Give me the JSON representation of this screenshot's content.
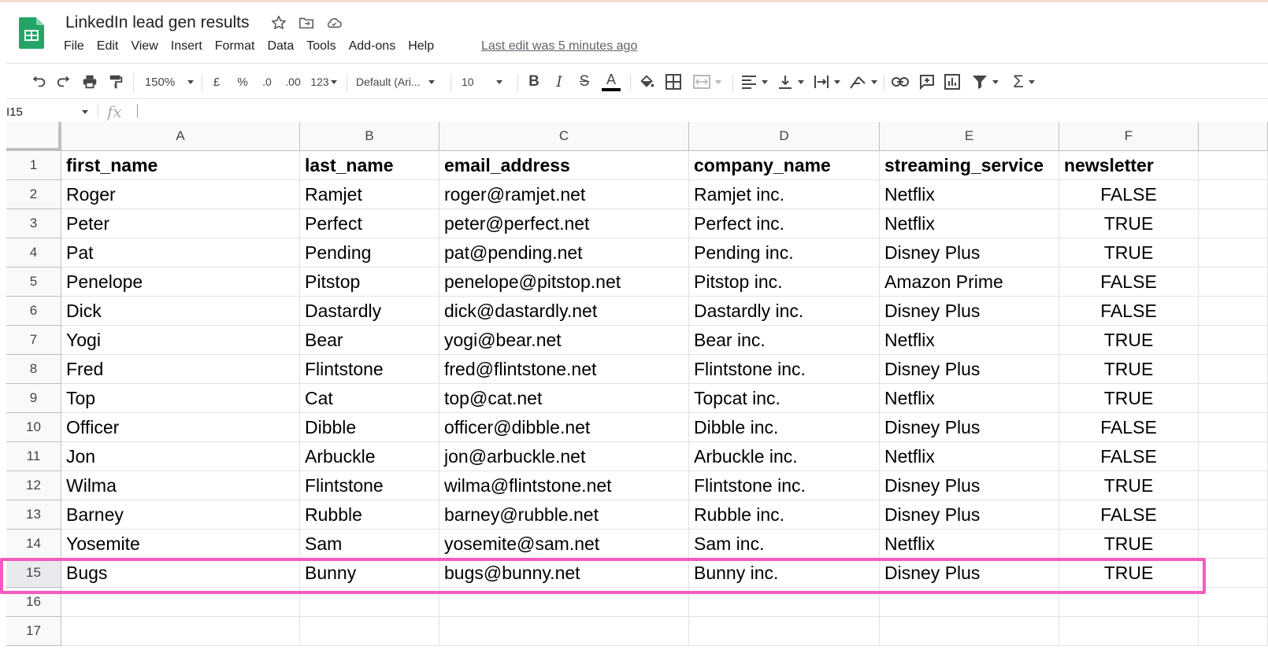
{
  "app": {
    "doc_title": "LinkedIn lead gen results",
    "menu": [
      "File",
      "Edit",
      "View",
      "Insert",
      "Format",
      "Data",
      "Tools",
      "Add-ons",
      "Help"
    ],
    "last_edit": "Last edit was 5 minutes ago",
    "brand_color": "#23a566"
  },
  "toolbar": {
    "zoom": "150%",
    "currency": "£",
    "percent": "%",
    "decrease_decimal": ".0",
    "increase_decimal": ".00",
    "more_formats": "123",
    "font": "Default (Ari...",
    "font_size": "10",
    "bold": "B",
    "italic": "I",
    "strike": "S",
    "text_color": "A"
  },
  "formula_bar": {
    "name_box": "I15",
    "fx": "fx",
    "formula": ""
  },
  "sheet": {
    "columns": [
      "A",
      "B",
      "C",
      "D",
      "E",
      "F"
    ],
    "row_numbers": [
      "1",
      "2",
      "3",
      "4",
      "5",
      "6",
      "7",
      "8",
      "9",
      "10",
      "11",
      "12",
      "13",
      "14",
      "15",
      "16",
      "17"
    ],
    "header": [
      "first_name",
      "last_name",
      "email_address",
      "company_name",
      "streaming_service",
      "newsletter"
    ],
    "rows": [
      [
        "Roger",
        "Ramjet",
        "roger@ramjet.net",
        "Ramjet inc.",
        "Netflix",
        "FALSE"
      ],
      [
        "Peter",
        "Perfect",
        "peter@perfect.net",
        "Perfect inc.",
        "Netflix",
        "TRUE"
      ],
      [
        "Pat",
        "Pending",
        "pat@pending.net",
        "Pending inc.",
        "Disney Plus",
        "TRUE"
      ],
      [
        "Penelope",
        "Pitstop",
        "penelope@pitstop.net",
        "Pitstop inc.",
        "Amazon Prime",
        "FALSE"
      ],
      [
        "Dick",
        "Dastardly",
        "dick@dastardly.net",
        "Dastardly inc.",
        "Disney Plus",
        "FALSE"
      ],
      [
        "Yogi",
        "Bear",
        "yogi@bear.net",
        "Bear inc.",
        "Netflix",
        "TRUE"
      ],
      [
        "Fred",
        "Flintstone",
        "fred@flintstone.net",
        "Flintstone inc.",
        "Disney Plus",
        "TRUE"
      ],
      [
        "Top",
        "Cat",
        "top@cat.net",
        "Topcat inc.",
        "Netflix",
        "TRUE"
      ],
      [
        "Officer",
        "Dibble",
        "officer@dibble.net",
        "Dibble inc.",
        "Disney Plus",
        "FALSE"
      ],
      [
        "Jon",
        "Arbuckle",
        "jon@arbuckle.net",
        "Arbuckle inc.",
        "Netflix",
        "FALSE"
      ],
      [
        "Wilma",
        "Flintstone",
        "wilma@flintstone.net",
        "Flintstone inc.",
        "Disney Plus",
        "TRUE"
      ],
      [
        "Barney",
        "Rubble",
        "barney@rubble.net",
        "Rubble inc.",
        "Disney Plus",
        "FALSE"
      ],
      [
        "Yosemite",
        "Sam",
        "yosemite@sam.net",
        "Sam inc.",
        "Netflix",
        "TRUE"
      ],
      [
        "Bugs",
        "Bunny",
        "bugs@bunny.net",
        "Bunny inc.",
        "Disney Plus",
        "TRUE"
      ]
    ],
    "highlight_color": "#f55bc1",
    "highlighted_row": "15"
  }
}
